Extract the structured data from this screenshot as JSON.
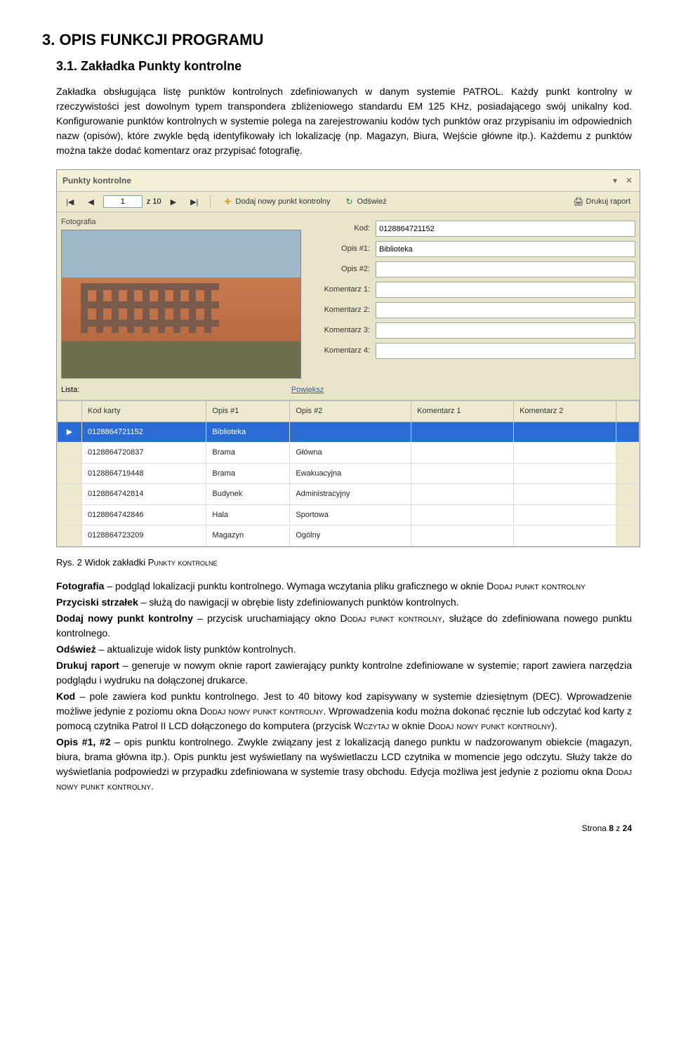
{
  "h1": "3. OPIS FUNKCJI PROGRAMU",
  "h2": "3.1. Zakładka Punkty kontrolne",
  "intro": "Zakładka obsługująca listę punktów kontrolnych zdefiniowanych w danym systemie PATROL. Każdy punkt kontrolny w rzeczywistości jest dowolnym typem transpondera zbliżeniowego standardu EM 125 KHz, posiadającego swój unikalny kod. Konfigurowanie punktów kontrolnych w systemie polega na zarejestrowaniu kodów tych punktów oraz przypisaniu im odpowiednich nazw (opisów), które zwykle będą identyfikowały ich lokalizację (np. Magazyn, Biura, Wejście główne itp.). Każdemu z punktów można także dodać komentarz oraz przypisać fotografię.",
  "window": {
    "title": "Punkty kontrolne",
    "min_icon": "▾",
    "close_icon": "✕"
  },
  "toolbar": {
    "nav_first": "|◀",
    "nav_prev": "◀",
    "page_value": "1",
    "page_total_prefix": "z ",
    "page_total": "10",
    "nav_next": "▶",
    "nav_last": "▶|",
    "add_icon": "✚",
    "add_label": "Dodaj nowy punkt kontrolny",
    "refresh_icon": "↻",
    "refresh_label": "Odśwież",
    "print_icon": "🖨",
    "print_label": "Drukuj raport"
  },
  "photo_label": "Fotografia",
  "lista_label": "Lista:",
  "zoom_label": "Powiększ",
  "fields": {
    "kod_label": "Kod:",
    "kod_value": "0128864721152",
    "opis1_label": "Opis #1:",
    "opis1_value": "Biblioteka",
    "opis2_label": "Opis #2:",
    "opis2_value": "",
    "k1_label": "Komentarz 1:",
    "k1_value": "",
    "k2_label": "Komentarz 2:",
    "k2_value": "",
    "k3_label": "Komentarz 3:",
    "k3_value": "",
    "k4_label": "Komentarz 4:",
    "k4_value": ""
  },
  "grid": {
    "headers": [
      "",
      "Kod karty",
      "Opis #1",
      "Opis #2",
      "Komentarz 1",
      "Komentarz 2",
      ""
    ],
    "rows": [
      {
        "handle": "▶",
        "kod": "0128864721152",
        "o1": "Biblioteka",
        "o2": "",
        "k1": "",
        "k2": "",
        "selected": true
      },
      {
        "handle": "",
        "kod": "0128864720837",
        "o1": "Brama",
        "o2": "Główna",
        "k1": "",
        "k2": "",
        "selected": false
      },
      {
        "handle": "",
        "kod": "0128864719448",
        "o1": "Brama",
        "o2": "Ewakuacyjna",
        "k1": "",
        "k2": "",
        "selected": false
      },
      {
        "handle": "",
        "kod": "0128864742814",
        "o1": "Budynek",
        "o2": "Administracyjny",
        "k1": "",
        "k2": "",
        "selected": false
      },
      {
        "handle": "",
        "kod": "0128864742846",
        "o1": "Hala",
        "o2": "Sportowa",
        "k1": "",
        "k2": "",
        "selected": false
      },
      {
        "handle": "",
        "kod": "0128864723209",
        "o1": "Magazyn",
        "o2": "Ogólny",
        "k1": "",
        "k2": "",
        "selected": false
      }
    ]
  },
  "caption_prefix": "Rys. 2 Widok zakładki ",
  "caption_sc": "Punkty kontrolne",
  "desc": {
    "foto_t": "Fotografia",
    "foto_b": " – podgląd lokalizacji punktu kontrolnego. Wymaga wczytania pliku graficznego w oknie ",
    "foto_sc": "Dodaj punkt kontrolny",
    "arrows_t": "Przyciski strzałek",
    "arrows_b": " – służą do nawigacji w obrębie listy zdefiniowanych punktów kontrolnych.",
    "add_t": "Dodaj nowy punkt kontrolny",
    "add_b1": " – przycisk uruchamiający okno ",
    "add_sc": "Dodaj punkt kontrolny",
    "add_b2": ", służące do zdefiniowana nowego punktu kontrolnego.",
    "ref_t": "Odśwież",
    "ref_b": " – aktualizuje widok listy punktów kontrolnych.",
    "rep_t": "Drukuj raport",
    "rep_b": " – generuje w nowym oknie raport zawierający punkty kontrolne zdefiniowane w systemie; raport zawiera narzędzia podglądu i wydruku na dołączonej drukarce.",
    "kod_t": "Kod",
    "kod_b1": " – pole zawiera kod punktu kontrolnego. Jest to 40 bitowy kod zapisywany w systemie dziesiętnym (DEC). Wprowadzenie możliwe jedynie z poziomu okna ",
    "kod_sc1": "Dodaj nowy punkt kontrolny",
    "kod_b2": ". Wprowadzenia kodu można dokonać ręcznie lub odczytać kod karty z pomocą czytnika Patrol II LCD dołączonego do komputera (przycisk ",
    "kod_sc2": "Wczytaj",
    "kod_b3": " w oknie ",
    "kod_sc3": "Dodaj nowy punkt kontrolny",
    "kod_b4": ").",
    "opis_t": "Opis #1, #2",
    "opis_b1": " – opis punktu kontrolnego. Zwykle związany jest z lokalizacją danego punktu w nadzorowanym obiekcie (magazyn, biura, brama główna itp.). Opis punktu jest wyświetlany na wyświetlaczu LCD czytnika w momencie jego odczytu. Służy także do wyświetlania podpowiedzi w przypadku zdefiniowana w systemie trasy obchodu. Edycja możliwa jest jedynie z poziomu okna ",
    "opis_sc": "Dodaj nowy punkt kontrolny",
    "opis_b2": "."
  },
  "footer_prefix": "Strona ",
  "footer_page": "8",
  "footer_mid": " z ",
  "footer_total": "24"
}
